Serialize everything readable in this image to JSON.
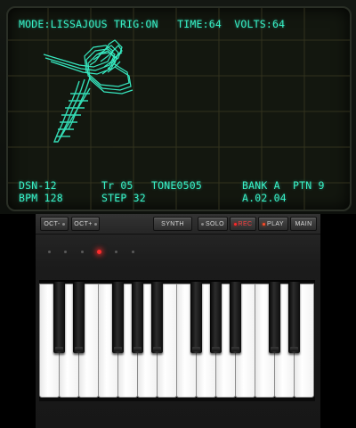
{
  "scope": {
    "status_line": "MODE:LISSAJOUS TRIG:ON   TIME:64  VOLTS:64",
    "info_left_1": "DSN-12",
    "info_left_2": "BPM 128",
    "info_mid_1": "Tr 05",
    "info_mid_2": "STEP 32",
    "info_tone": "TONE0505",
    "info_bank": "BANK A  PTN 9",
    "info_version": "A.02.04",
    "trace_color": "#38f2c8"
  },
  "toolbar": {
    "oct_down": "OCT-",
    "oct_up": "OCT+",
    "synth": "SYNTH",
    "solo": "SOLO",
    "rec": "REC",
    "play": "PLAY",
    "main": "MAIN"
  },
  "sequencer": {
    "active_led_index": 3,
    "led_count": 6
  },
  "keyboard": {
    "white_keys": 14,
    "black_keys": 10
  }
}
